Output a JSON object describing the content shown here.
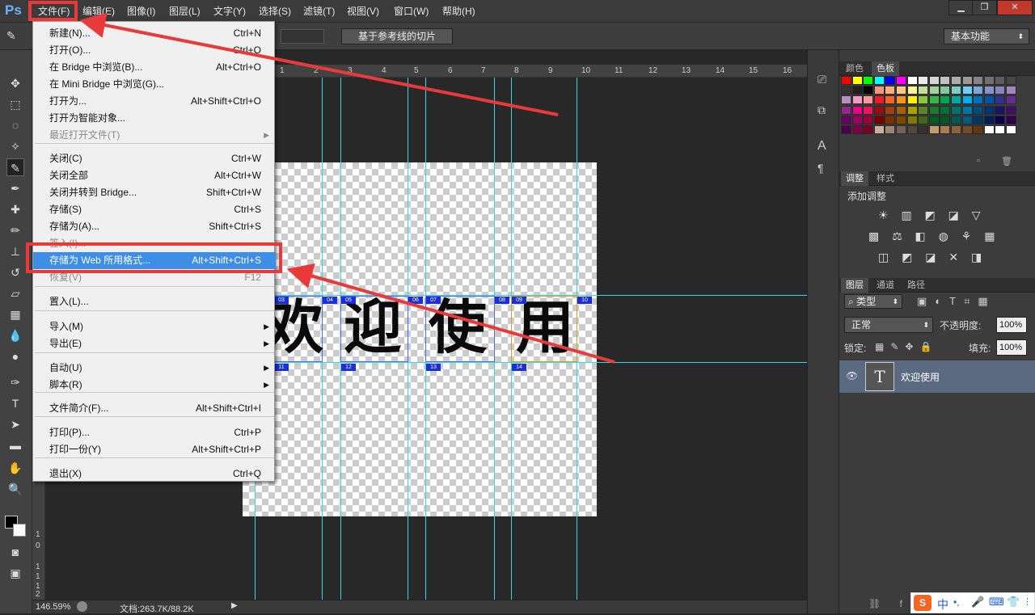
{
  "menubar": {
    "logo": "Ps",
    "items": [
      "文件(F)",
      "编辑(E)",
      "图像(I)",
      "图层(L)",
      "文字(Y)",
      "选择(S)",
      "滤镜(T)",
      "视图(V)",
      "窗口(W)",
      "帮助(H)"
    ],
    "window_buttons": [
      "▁",
      "❐",
      "✕"
    ]
  },
  "options_bar": {
    "slice_from_guides_button": "基于参考线的切片",
    "workspace": "基本功能"
  },
  "ruler_top": [
    "1",
    "2",
    "3",
    "4",
    "5",
    "6",
    "7",
    "8",
    "9",
    "10",
    "11",
    "12",
    "13",
    "14",
    "15",
    "16"
  ],
  "ruler_left": [
    "1",
    "0",
    "1",
    "1",
    "1",
    "2"
  ],
  "status": {
    "zoom": "146.59%",
    "doc_info": "文档:263.7K/88.2K"
  },
  "canvas_text": [
    "欢",
    "迎",
    "使",
    "用"
  ],
  "slice_tags_top": [
    "03",
    "04",
    "05",
    "06",
    "07",
    "08",
    "09",
    "10"
  ],
  "slice_tags_bottom": [
    "11",
    "12",
    "13",
    "14"
  ],
  "file_menu": {
    "rows": [
      {
        "label": "新建(N)...",
        "shortcut": "Ctrl+N"
      },
      {
        "label": "打开(O)...",
        "shortcut": "Ctrl+O"
      },
      {
        "label": "在 Bridge 中浏览(B)...",
        "shortcut": "Alt+Ctrl+O"
      },
      {
        "label": "在 Mini Bridge 中浏览(G)...",
        "shortcut": ""
      },
      {
        "label": "打开为...",
        "shortcut": "Alt+Shift+Ctrl+O"
      },
      {
        "label": "打开为智能对象...",
        "shortcut": ""
      },
      {
        "label": "最近打开文件(T)",
        "shortcut": ""
      },
      {
        "label": "关闭(C)",
        "shortcut": "Ctrl+W"
      },
      {
        "label": "关闭全部",
        "shortcut": "Alt+Ctrl+W"
      },
      {
        "label": "关闭并转到 Bridge...",
        "shortcut": "Shift+Ctrl+W"
      },
      {
        "label": "存储(S)",
        "shortcut": "Ctrl+S"
      },
      {
        "label": "存储为(A)...",
        "shortcut": "Shift+Ctrl+S"
      },
      {
        "label": "签入(I)...",
        "shortcut": ""
      },
      {
        "label": "存储为 Web 所用格式...",
        "shortcut": "Alt+Shift+Ctrl+S"
      },
      {
        "label": "恢复(V)",
        "shortcut": "F12"
      },
      {
        "label": "置入(L)...",
        "shortcut": ""
      },
      {
        "label": "导入(M)",
        "shortcut": ""
      },
      {
        "label": "导出(E)",
        "shortcut": ""
      },
      {
        "label": "自动(U)",
        "shortcut": ""
      },
      {
        "label": "脚本(R)",
        "shortcut": ""
      },
      {
        "label": "文件简介(F)...",
        "shortcut": "Alt+Shift+Ctrl+I"
      },
      {
        "label": "打印(P)...",
        "shortcut": "Ctrl+P"
      },
      {
        "label": "打印一份(Y)",
        "shortcut": "Alt+Shift+Ctrl+P"
      },
      {
        "label": "退出(X)",
        "shortcut": "Ctrl+Q"
      }
    ]
  },
  "swatches_panel": {
    "tabs": [
      "颜色",
      "色板"
    ]
  },
  "adjustments_panel": {
    "tabs": [
      "调整",
      "样式"
    ],
    "title": "添加调整"
  },
  "layers_panel": {
    "tabs": [
      "图层",
      "通道",
      "路径"
    ],
    "filter": "类型",
    "blend_mode": "正常",
    "opacity_label": "不透明度:",
    "opacity": "100%",
    "lock_label": "锁定:",
    "fill_label": "填充:",
    "fill": "100%",
    "layer_thumb": "T",
    "layer_name": "欢迎使用"
  },
  "ime_bar": {
    "logo": "S",
    "lang": "中",
    "items": [
      "•,",
      "🎤",
      "⌨",
      "👕",
      "⋮⋮"
    ]
  },
  "colors": {
    "highlight": "#3e8ee8",
    "annotation": "#e83a3a",
    "guide": "#34d7e6"
  }
}
